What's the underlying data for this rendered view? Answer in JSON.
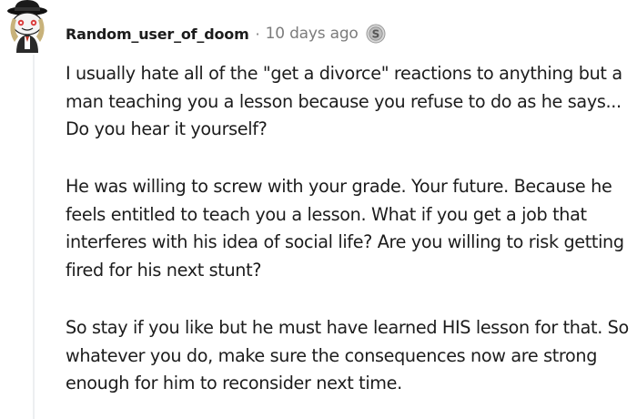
{
  "comment": {
    "username": "Random_user_of_doom",
    "separator": "·",
    "timestamp": "10 days ago",
    "award_icon": "silver-award-icon",
    "avatar_icon": "snoo-avatar-icon",
    "paragraphs": [
      "I usually hate all of the \"get a divorce\" reactions to anything but a man teaching you a lesson because you refuse to do as he says... Do you hear it yourself?",
      "He was willing to screw with your grade. Your future. Because he feels entitled to teach you a lesson. What if you get a job that interferes with his idea of social life? Are you willing to risk getting fired for his next stunt?",
      "So stay if you like but he must have learned HIS lesson for that. So whatever you do, make sure the consequences now are strong enough for him to reconsider next time."
    ]
  },
  "colors": {
    "text": "#1c1c1c",
    "meta": "#7c7c7c",
    "thread_line": "#edeff1"
  }
}
